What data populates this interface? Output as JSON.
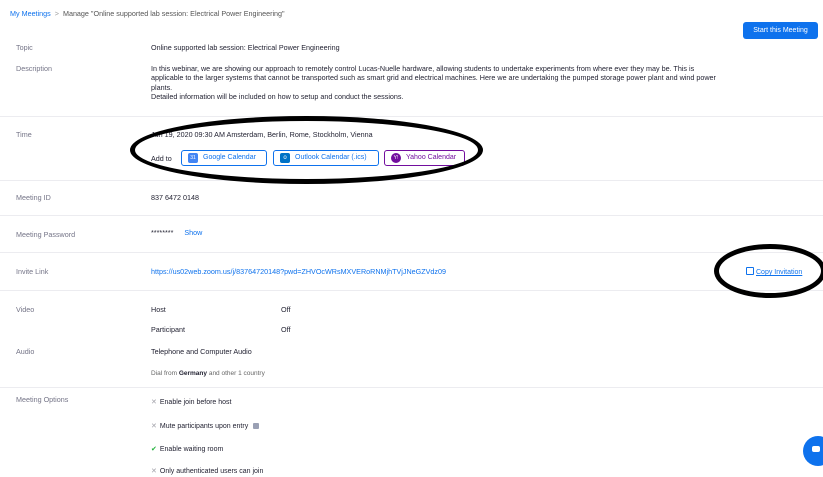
{
  "breadcrumb": {
    "parent": "My Meetings",
    "separator": ">",
    "current": "Manage \"Online supported lab session: Electrical Power Engineering\""
  },
  "start_button": "Start this Meeting",
  "topic": {
    "label": "Topic",
    "value": "Online supported lab session: Electrical Power Engineering"
  },
  "description": {
    "label": "Description",
    "paragraph1": "In this webinar, we are showing our approach to remotely control Lucas-Nuelle hardware, allowing students to undertake experiments from where ever they may be. This is applicable to the larger systems that cannot be transported such as smart grid and electrical machines. Here we are undertaking the pumped storage power plant and wind power plants.",
    "paragraph2": "Detailed information will be included on how to setup and conduct the sessions."
  },
  "time": {
    "label": "Time",
    "value": "Jun 19, 2020 09:30 AM Amsterdam, Berlin, Rome, Stockholm, Vienna",
    "add_to": "Add to",
    "calendars": [
      {
        "label": "Google Calendar",
        "icon": "google-calendar-icon",
        "icon_text": "31",
        "color": "#4285f4"
      },
      {
        "label": "Outlook Calendar (.ics)",
        "icon": "outlook-icon",
        "icon_text": "o",
        "color": "#0072c6"
      },
      {
        "label": "Yahoo Calendar",
        "icon": "yahoo-icon",
        "icon_text": "Y!",
        "color": "#720e9e"
      }
    ]
  },
  "meeting_id": {
    "label": "Meeting ID",
    "value": "837 6472 0148"
  },
  "meeting_password": {
    "label": "Meeting Password",
    "value": "********",
    "show": "Show"
  },
  "invite_link": {
    "label": "Invite Link",
    "url": "https://us02web.zoom.us/j/83764720148?pwd=ZHVOcWRsMXVERoRNMjhTVjJNeGZVdz09",
    "copy": "Copy Invitation"
  },
  "video": {
    "label": "Video",
    "host_label": "Host",
    "host_value": "Off",
    "participant_label": "Participant",
    "participant_value": "Off"
  },
  "audio": {
    "label": "Audio",
    "value": "Telephone and Computer Audio",
    "dial_prefix": "Dial from",
    "dial_country": "Germany",
    "dial_suffix": "and other 1 country"
  },
  "meeting_options": {
    "label": "Meeting Options",
    "items": [
      {
        "text": "Enable join before host",
        "enabled": false
      },
      {
        "text": "Mute participants upon entry",
        "enabled": false
      },
      {
        "text": "Enable waiting room",
        "enabled": true
      },
      {
        "text": "Only authenticated users can join",
        "enabled": false
      }
    ]
  },
  "colors": {
    "accent": "#0e72ed",
    "annotation": "#000000",
    "check": "#23b23d"
  }
}
